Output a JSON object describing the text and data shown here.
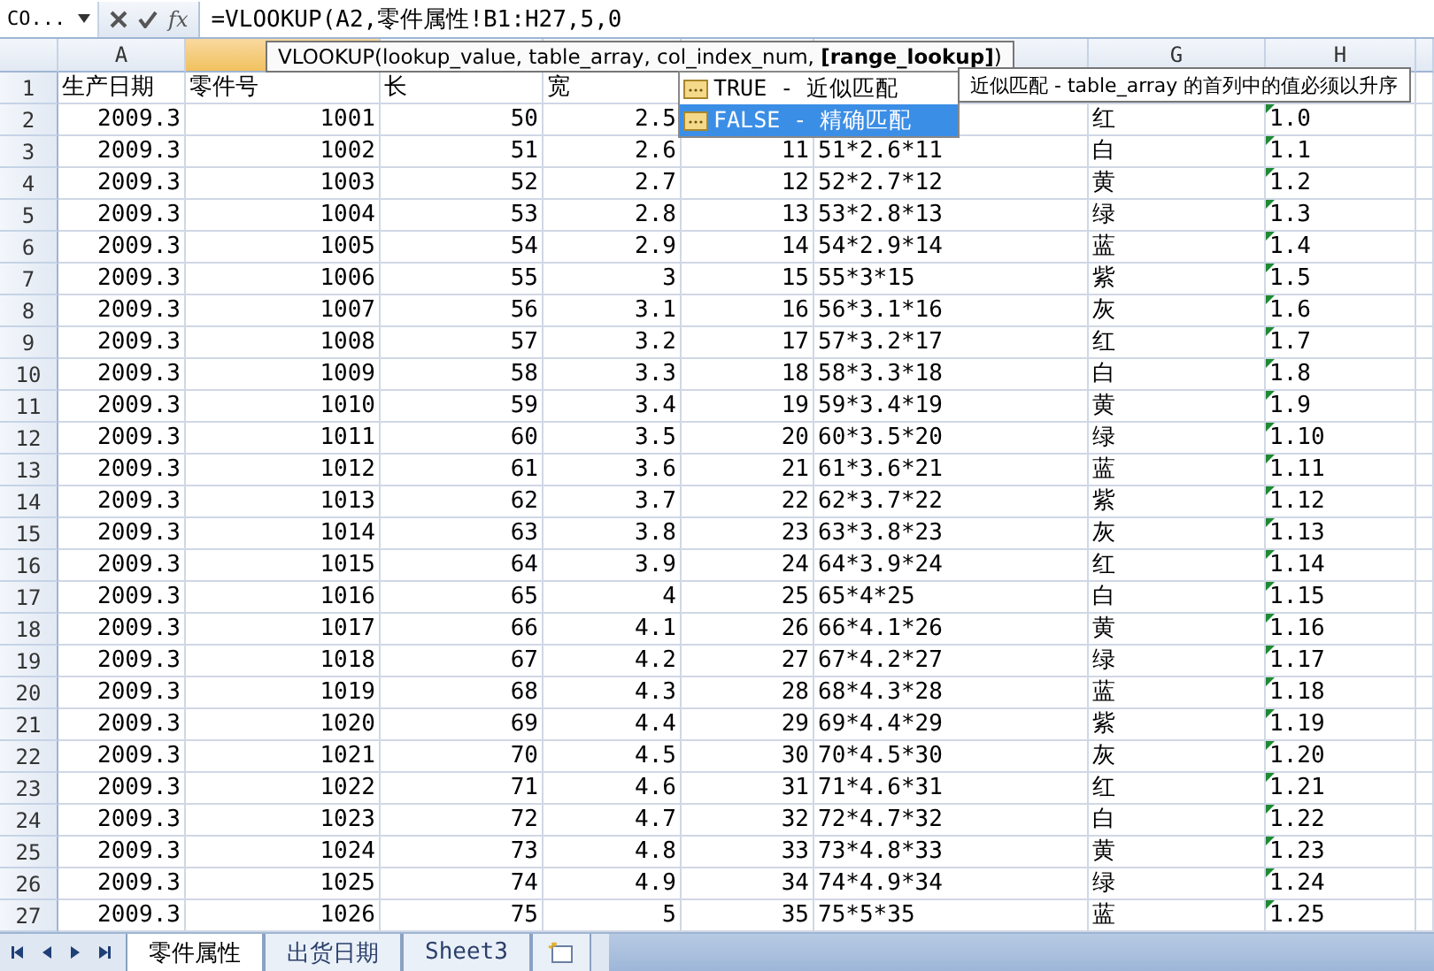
{
  "formula_bar": {
    "name_box": "CO...",
    "formula": "=VLOOKUP(A2,零件属性!B1:H27,5,0",
    "function_label": "fx"
  },
  "columns": [
    {
      "label": "A",
      "selected": false
    },
    {
      "selected": true
    },
    {
      "selected": false
    },
    {
      "selected": false
    },
    {
      "selected": false
    },
    {
      "selected": false
    },
    {
      "label": "G",
      "selected": false
    },
    {
      "label": "H",
      "selected": false
    }
  ],
  "syntax_tip": {
    "text": "VLOOKUP(lookup_value, table_array, col_index_num, **[range_lookup]**)"
  },
  "autocomplete": [
    {
      "label": "TRUE - 近似匹配",
      "selected": false
    },
    {
      "label": "FALSE - 精确匹配",
      "selected": true
    }
  ],
  "hint": "近似匹配 - table_array 的首列中的值必须以升序",
  "rows": [
    {
      "n": "1",
      "cells": [
        "生产日期",
        "零件号",
        "长",
        "宽",
        null,
        null,
        null,
        null
      ]
    },
    {
      "n": "2",
      "cells": [
        "2009.3",
        "1001",
        "50",
        "2.5",
        null,
        null,
        "红",
        "1.0"
      ]
    },
    {
      "n": "3",
      "cells": [
        "2009.3",
        "1002",
        "51",
        "2.6",
        "11",
        "51*2.6*11",
        "白",
        "1.1"
      ]
    },
    {
      "n": "4",
      "cells": [
        "2009.3",
        "1003",
        "52",
        "2.7",
        "12",
        "52*2.7*12",
        "黄",
        "1.2"
      ]
    },
    {
      "n": "5",
      "cells": [
        "2009.3",
        "1004",
        "53",
        "2.8",
        "13",
        "53*2.8*13",
        "绿",
        "1.3"
      ]
    },
    {
      "n": "6",
      "cells": [
        "2009.3",
        "1005",
        "54",
        "2.9",
        "14",
        "54*2.9*14",
        "蓝",
        "1.4"
      ]
    },
    {
      "n": "7",
      "cells": [
        "2009.3",
        "1006",
        "55",
        "3",
        "15",
        "55*3*15",
        "紫",
        "1.5"
      ]
    },
    {
      "n": "8",
      "cells": [
        "2009.3",
        "1007",
        "56",
        "3.1",
        "16",
        "56*3.1*16",
        "灰",
        "1.6"
      ]
    },
    {
      "n": "9",
      "cells": [
        "2009.3",
        "1008",
        "57",
        "3.2",
        "17",
        "57*3.2*17",
        "红",
        "1.7"
      ]
    },
    {
      "n": "10",
      "cells": [
        "2009.3",
        "1009",
        "58",
        "3.3",
        "18",
        "58*3.3*18",
        "白",
        "1.8"
      ]
    },
    {
      "n": "11",
      "cells": [
        "2009.3",
        "1010",
        "59",
        "3.4",
        "19",
        "59*3.4*19",
        "黄",
        "1.9"
      ]
    },
    {
      "n": "12",
      "cells": [
        "2009.3",
        "1011",
        "60",
        "3.5",
        "20",
        "60*3.5*20",
        "绿",
        "1.10"
      ]
    },
    {
      "n": "13",
      "cells": [
        "2009.3",
        "1012",
        "61",
        "3.6",
        "21",
        "61*3.6*21",
        "蓝",
        "1.11"
      ]
    },
    {
      "n": "14",
      "cells": [
        "2009.3",
        "1013",
        "62",
        "3.7",
        "22",
        "62*3.7*22",
        "紫",
        "1.12"
      ]
    },
    {
      "n": "15",
      "cells": [
        "2009.3",
        "1014",
        "63",
        "3.8",
        "23",
        "63*3.8*23",
        "灰",
        "1.13"
      ]
    },
    {
      "n": "16",
      "cells": [
        "2009.3",
        "1015",
        "64",
        "3.9",
        "24",
        "64*3.9*24",
        "红",
        "1.14"
      ]
    },
    {
      "n": "17",
      "cells": [
        "2009.3",
        "1016",
        "65",
        "4",
        "25",
        "65*4*25",
        "白",
        "1.15"
      ]
    },
    {
      "n": "18",
      "cells": [
        "2009.3",
        "1017",
        "66",
        "4.1",
        "26",
        "66*4.1*26",
        "黄",
        "1.16"
      ]
    },
    {
      "n": "19",
      "cells": [
        "2009.3",
        "1018",
        "67",
        "4.2",
        "27",
        "67*4.2*27",
        "绿",
        "1.17"
      ]
    },
    {
      "n": "20",
      "cells": [
        "2009.3",
        "1019",
        "68",
        "4.3",
        "28",
        "68*4.3*28",
        "蓝",
        "1.18"
      ]
    },
    {
      "n": "21",
      "cells": [
        "2009.3",
        "1020",
        "69",
        "4.4",
        "29",
        "69*4.4*29",
        "紫",
        "1.19"
      ]
    },
    {
      "n": "22",
      "cells": [
        "2009.3",
        "1021",
        "70",
        "4.5",
        "30",
        "70*4.5*30",
        "灰",
        "1.20"
      ]
    },
    {
      "n": "23",
      "cells": [
        "2009.3",
        "1022",
        "71",
        "4.6",
        "31",
        "71*4.6*31",
        "红",
        "1.21"
      ]
    },
    {
      "n": "24",
      "cells": [
        "2009.3",
        "1023",
        "72",
        "4.7",
        "32",
        "72*4.7*32",
        "白",
        "1.22"
      ]
    },
    {
      "n": "25",
      "cells": [
        "2009.3",
        "1024",
        "73",
        "4.8",
        "33",
        "73*4.8*33",
        "黄",
        "1.23"
      ]
    },
    {
      "n": "26",
      "cells": [
        "2009.3",
        "1025",
        "74",
        "4.9",
        "34",
        "74*4.9*34",
        "绿",
        "1.24"
      ]
    },
    {
      "n": "27",
      "cells": [
        "2009.3",
        "1026",
        "75",
        "5",
        "35",
        "75*5*35",
        "蓝",
        "1.25"
      ]
    }
  ],
  "sheet_tabs": [
    {
      "label": "零件属性",
      "selected": true
    },
    {
      "label": "出货日期",
      "selected": false
    },
    {
      "label": "Sheet3",
      "selected": false
    }
  ]
}
